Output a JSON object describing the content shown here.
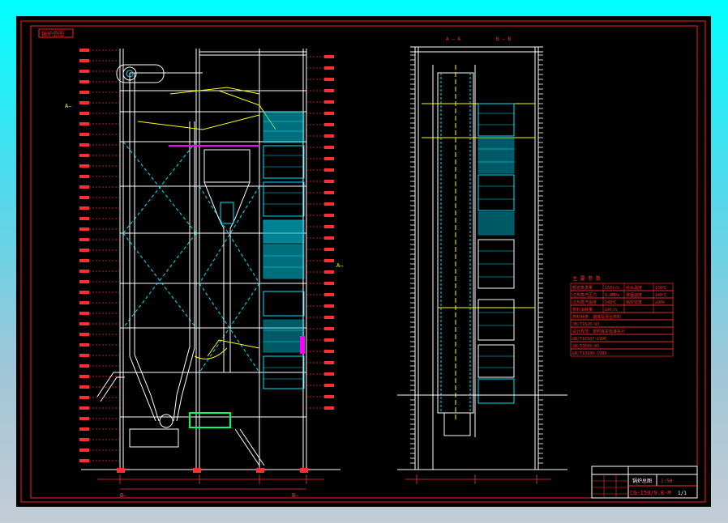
{
  "colors": {
    "background": "#000000",
    "frame": "#ff2020",
    "structure": "#ffffff",
    "dimension": "#ff3030",
    "centerline": "#ffff00",
    "heating_surface": "#00e5ff",
    "pipe": "#00ff66",
    "accent": "#ff00ff"
  },
  "drawing": {
    "corner_stamp": "锅炉总图",
    "section_elevation_markers": [
      "A—",
      "A—"
    ],
    "section_left_title": "A — A",
    "section_right_title": "B — B",
    "axis_label_left": "B—",
    "axis_label_right": "B—"
  },
  "tech_table": {
    "title": "主 要 参 数",
    "rows": [
      [
        "额定蒸发量",
        "150t/h",
        "给水温度",
        "150℃"
      ],
      [
        "过热蒸汽压力",
        "9.8MPa",
        "排烟温度",
        "140℃"
      ],
      [
        "过热蒸汽温度",
        "540℃",
        "锅炉效率",
        "≥90%"
      ],
      [
        "燃料消耗量",
        "24t/h",
        "",
        ""
      ],
      [
        "燃料种类：烟煤及混合燃料",
        "",
        "",
        ""
      ],
      [
        "JB/T1620-93",
        "",
        "",
        ""
      ],
      [
        "设计规范：按照有关标准执行",
        "",
        "",
        ""
      ],
      [
        "GB/T16507-1996",
        "",
        "",
        ""
      ],
      [
        "JB/T3505-93",
        "",
        "",
        ""
      ],
      [
        "GB/T10180-1988",
        "",
        "",
        ""
      ]
    ]
  },
  "title_block": {
    "drawing_name": "锅炉总图",
    "model_code": "CG-150/9.8-M",
    "scale": "1:50",
    "sheet": "1/1"
  }
}
